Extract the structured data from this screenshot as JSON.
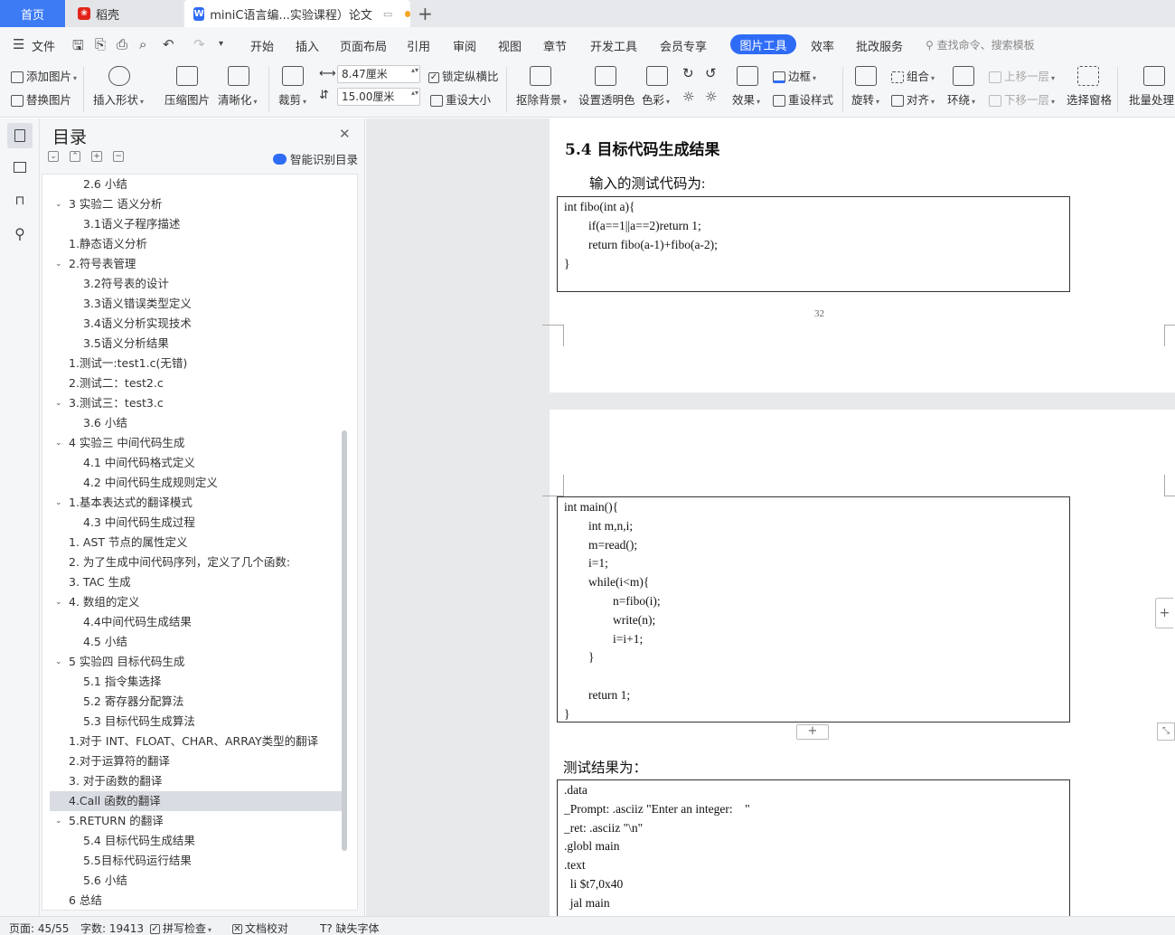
{
  "tabs": {
    "home": "首页",
    "daoke": "稻壳",
    "document": "miniC语言编...实验课程）论文"
  },
  "menu": {
    "file": "文件",
    "items": [
      "开始",
      "插入",
      "页面布局",
      "引用",
      "审阅",
      "视图",
      "章节",
      "开发工具",
      "会员专享"
    ],
    "active": "图片工具",
    "after": [
      "效率",
      "批改服务"
    ],
    "search": "查找命令、搜索模板"
  },
  "ribbon": {
    "add_picture": "添加图片",
    "replace_picture": "替换图片",
    "insert_shape": "插入形状",
    "compress": "压缩图片",
    "clarify": "清晰化",
    "crop": "裁剪",
    "width": "8.47厘米",
    "height": "15.00厘米",
    "lock_ratio": "锁定纵横比",
    "reset_size": "重设大小",
    "remove_bg": "抠除背景",
    "set_transparent": "设置透明色",
    "color": "色彩",
    "effects": "效果",
    "border": "边框",
    "reset_style": "重设样式",
    "rotate": "旋转",
    "group": "组合",
    "align": "对齐",
    "wrap": "环绕",
    "bring_forward": "上移一层",
    "send_backward": "下移一层",
    "select_pane": "选择窗格",
    "batch": "批量处理"
  },
  "toc": {
    "title": "目录",
    "smart": "智能识别目录",
    "items": [
      {
        "text": "2.6  小结",
        "level": 2,
        "arrow": false
      },
      {
        "text": "3  实验二  语义分析",
        "level": 1,
        "arrow": true
      },
      {
        "text": "3.1语义子程序描述",
        "level": 2,
        "arrow": false
      },
      {
        "text": "1.静态语义分析",
        "level": 1.5,
        "arrow": false
      },
      {
        "text": "2.符号表管理",
        "level": 1,
        "arrow": true
      },
      {
        "text": "3.2符号表的设计",
        "level": 2,
        "arrow": false
      },
      {
        "text": "3.3语义错误类型定义",
        "level": 2,
        "arrow": false
      },
      {
        "text": "3.4语义分析实现技术",
        "level": 2,
        "arrow": false
      },
      {
        "text": "3.5语义分析结果",
        "level": 2,
        "arrow": false
      },
      {
        "text": "1.测试一:test1.c(无错)",
        "level": 1.5,
        "arrow": false
      },
      {
        "text": "2.测试二：test2.c",
        "level": 1.5,
        "arrow": false
      },
      {
        "text": "3.测试三：test3.c",
        "level": 1,
        "arrow": true
      },
      {
        "text": "3.6 小结",
        "level": 2,
        "arrow": false
      },
      {
        "text": "4  实验三  中间代码生成",
        "level": 1,
        "arrow": true
      },
      {
        "text": "4.1  中间代码格式定义",
        "level": 2,
        "arrow": false
      },
      {
        "text": "4.2  中间代码生成规则定义",
        "level": 2,
        "arrow": false
      },
      {
        "text": "1.基本表达式的翻译模式",
        "level": 1,
        "arrow": true
      },
      {
        "text": "4.3  中间代码生成过程",
        "level": 2,
        "arrow": false
      },
      {
        "text": "1.    AST 节点的属性定义",
        "level": 1.5,
        "arrow": false
      },
      {
        "text": "2.  为了生成中间代码序列，定义了几个函数:",
        "level": 1.5,
        "arrow": false
      },
      {
        "text": "3.  TAC 生成",
        "level": 1.5,
        "arrow": false
      },
      {
        "text": "4.  数组的定义",
        "level": 1,
        "arrow": true
      },
      {
        "text": "4.4中间代码生成结果",
        "level": 2,
        "arrow": false
      },
      {
        "text": "4.5  小结",
        "level": 2,
        "arrow": false
      },
      {
        "text": "5  实验四  目标代码生成",
        "level": 1,
        "arrow": true
      },
      {
        "text": "5.1  指令集选择",
        "level": 2,
        "arrow": false
      },
      {
        "text": "5.2  寄存器分配算法",
        "level": 2,
        "arrow": false
      },
      {
        "text": "5.3  目标代码生成算法",
        "level": 2,
        "arrow": false
      },
      {
        "text": "1.对于 INT、FLOAT、CHAR、ARRAY类型的翻译",
        "level": 1.5,
        "arrow": false
      },
      {
        "text": "2.对于运算符的翻译",
        "level": 1.5,
        "arrow": false
      },
      {
        "text": "3.  对于函数的翻译",
        "level": 1.5,
        "arrow": false
      },
      {
        "text": "4.Call 函数的翻译",
        "level": 1.5,
        "arrow": false,
        "selected": true
      },
      {
        "text": "5.RETURN 的翻译",
        "level": 1,
        "arrow": true
      },
      {
        "text": "5.4  目标代码生成结果",
        "level": 2,
        "arrow": false
      },
      {
        "text": "5.5目标代码运行结果",
        "level": 2,
        "arrow": false
      },
      {
        "text": "5.6  小结",
        "level": 2,
        "arrow": false
      },
      {
        "text": "6  总结",
        "level": 1.5,
        "arrow": false
      }
    ]
  },
  "document": {
    "heading": "5.4  目标代码生成结果",
    "intro": "输入的测试代码为:",
    "code1": [
      "int fibo(int a){",
      "        if(a==1||a==2)return 1;",
      "        return fibo(a-1)+fibo(a-2);",
      "}"
    ],
    "page_number": "32",
    "code2": [
      "int main(){",
      "        int m,n,i;",
      "        m=read();",
      "        i=1;",
      "        while(i<m){",
      "                n=fibo(i);",
      "                write(n);",
      "                i=i+1;",
      "        }",
      "",
      "        return 1;",
      "}"
    ],
    "result_label": "测试结果为：",
    "code3": [
      ".data",
      "_Prompt: .asciiz \"Enter an integer:    \"",
      "_ret: .asciiz \"\\n\"",
      ".globl main",
      ".text",
      "  li $t7,0x40",
      "  jal main"
    ]
  },
  "status": {
    "page": "页面: 45/55",
    "words": "字数: 19413",
    "spell": "拼写检查",
    "proof": "文档校对",
    "missing_font": "缺失字体"
  },
  "colors": {
    "accent": "#2f6cf6",
    "home_tab": "#3d7bf5"
  }
}
